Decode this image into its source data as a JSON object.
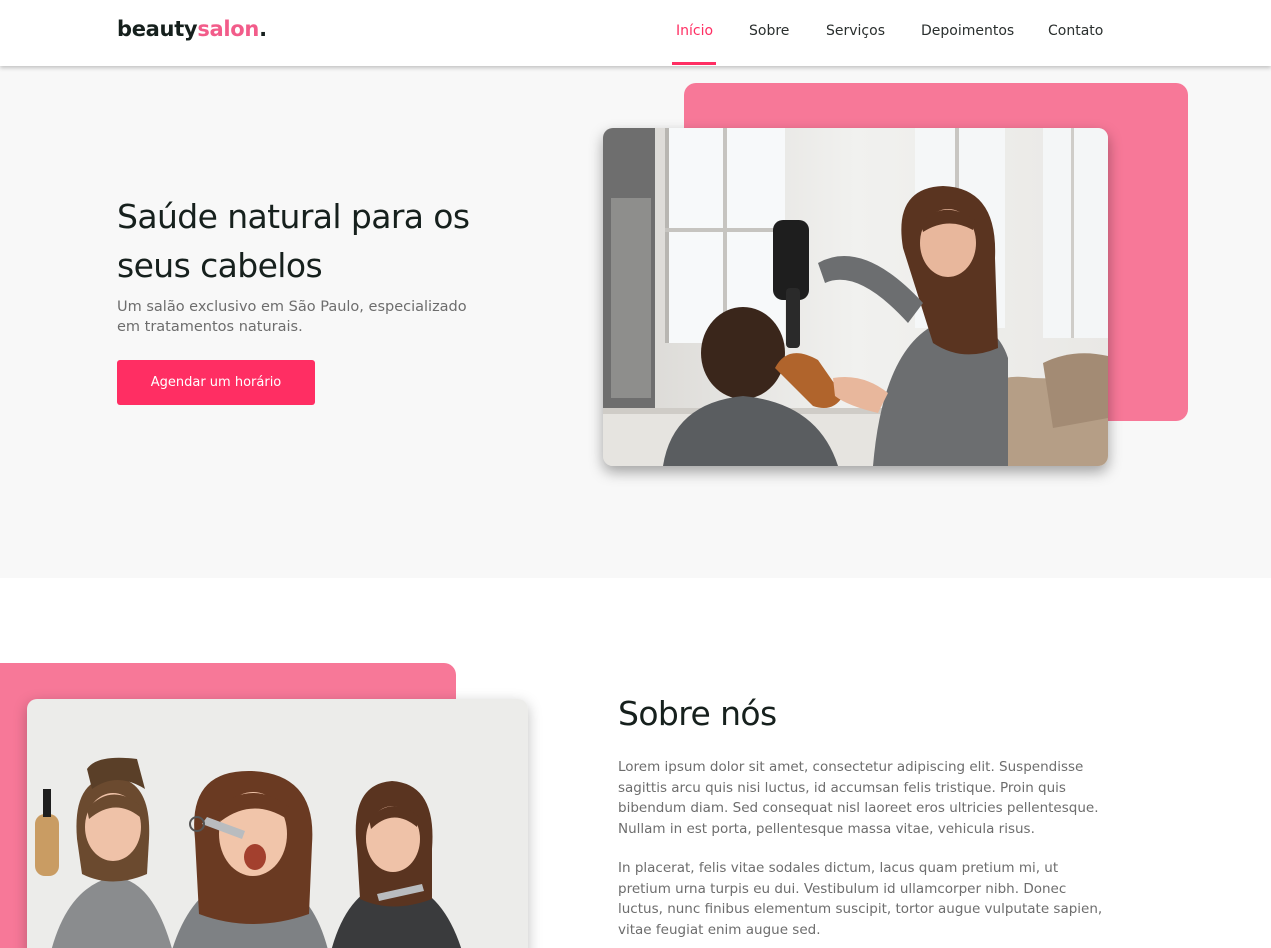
{
  "header": {
    "logo": {
      "part1": "beauty",
      "part2": "salon",
      "part3": "."
    },
    "nav": [
      {
        "label": "Início",
        "active": true
      },
      {
        "label": "Sobre",
        "active": false
      },
      {
        "label": "Serviços",
        "active": false
      },
      {
        "label": "Depoimentos",
        "active": false
      },
      {
        "label": "Contato",
        "active": false
      }
    ]
  },
  "hero": {
    "title": "Saúde natural para os seus cabelos",
    "subtitle": "Um salão exclusivo em São Paulo, especializado em tratamentos naturais.",
    "cta_label": "Agendar um horário"
  },
  "about": {
    "title": "Sobre nós",
    "paragraphs": [
      "Lorem ipsum dolor sit amet, consectetur adipiscing elit. Suspendisse sagittis arcu quis nisi luctus, id accumsan felis tristique. Proin quis bibendum diam. Sed consequat nisl laoreet eros ultricies pellentesque. Nullam in est porta, pellentesque massa vitae, vehicula risus.",
      "In placerat, felis vitae sodales dictum, lacus quam pretium mi, ut pretium urna turpis eu dui. Vestibulum id ullamcorper nibh. Donec luctus, nunc finibus elementum suscipit, tortor augue vulputate sapien, vitae feugiat enim augue sed."
    ]
  },
  "colors": {
    "accent": "#ff2e63",
    "pink_block": "#f77898",
    "logo_pink": "#f25c8a",
    "heading": "#16201d",
    "body_text": "#6d6d6d",
    "hero_bg": "#f8f8f8"
  }
}
